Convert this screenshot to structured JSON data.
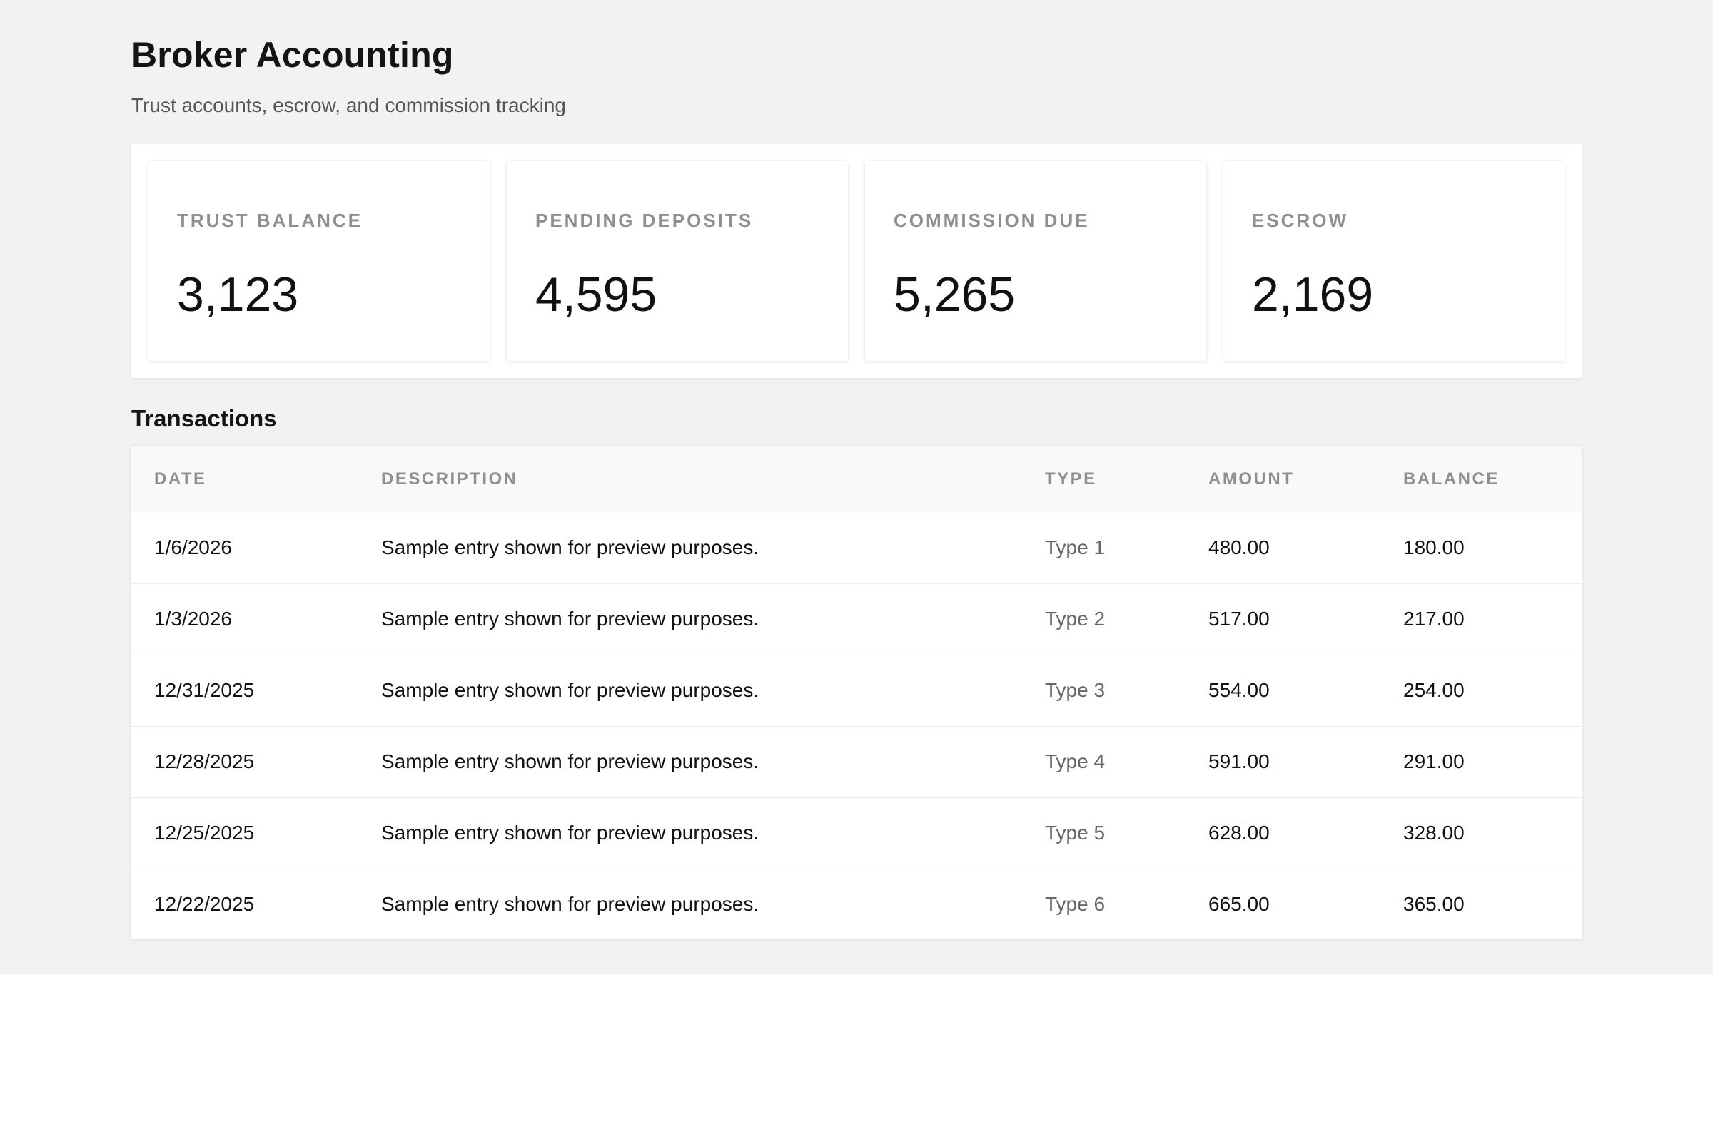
{
  "header": {
    "title": "Broker Accounting",
    "subtitle": "Trust accounts, escrow, and commission tracking"
  },
  "stats": [
    {
      "label": "TRUST BALANCE",
      "value": "3,123"
    },
    {
      "label": "PENDING DEPOSITS",
      "value": "4,595"
    },
    {
      "label": "COMMISSION DUE",
      "value": "5,265"
    },
    {
      "label": "ESCROW",
      "value": "2,169"
    }
  ],
  "transactions": {
    "title": "Transactions",
    "columns": [
      "DATE",
      "DESCRIPTION",
      "TYPE",
      "AMOUNT",
      "BALANCE"
    ],
    "rows": [
      {
        "date": "1/6/2026",
        "description": "Sample entry shown for preview purposes.",
        "type": "Type 1",
        "amount": "480.00",
        "balance": "180.00"
      },
      {
        "date": "1/3/2026",
        "description": "Sample entry shown for preview purposes.",
        "type": "Type 2",
        "amount": "517.00",
        "balance": "217.00"
      },
      {
        "date": "12/31/2025",
        "description": "Sample entry shown for preview purposes.",
        "type": "Type 3",
        "amount": "554.00",
        "balance": "254.00"
      },
      {
        "date": "12/28/2025",
        "description": "Sample entry shown for preview purposes.",
        "type": "Type 4",
        "amount": "591.00",
        "balance": "291.00"
      },
      {
        "date": "12/25/2025",
        "description": "Sample entry shown for preview purposes.",
        "type": "Type 5",
        "amount": "628.00",
        "balance": "328.00"
      },
      {
        "date": "12/22/2025",
        "description": "Sample entry shown for preview purposes.",
        "type": "Type 6",
        "amount": "665.00",
        "balance": "365.00"
      }
    ]
  }
}
